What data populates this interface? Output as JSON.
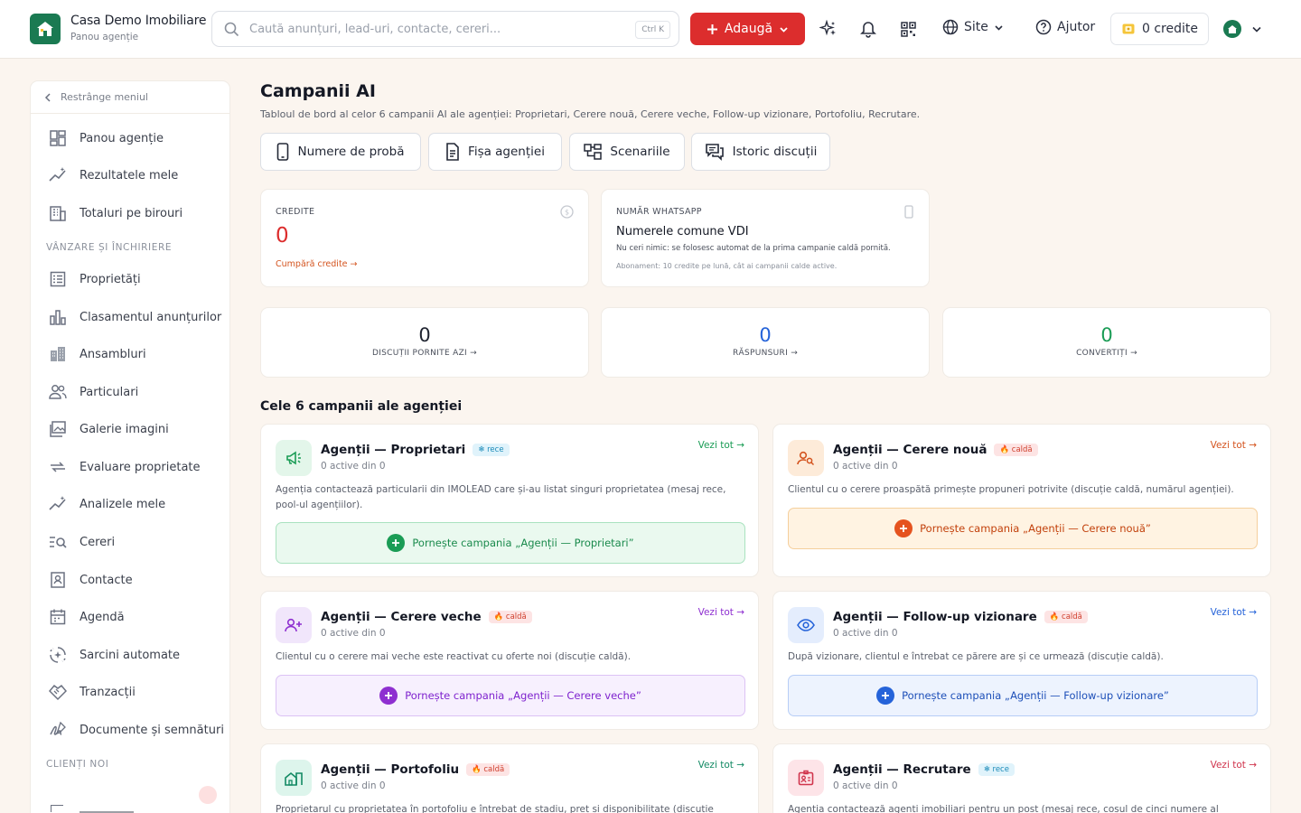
{
  "header": {
    "brand_title": "Casa Demo Imobiliare",
    "brand_sub": "Panou agenție",
    "search_placeholder": "Caută anunțuri, lead-uri, contacte, cereri...",
    "search_kbd": "Ctrl K",
    "add_label": "Adaugă",
    "site_label": "Site",
    "help_label": "Ajutor",
    "credits_label": "0  credite"
  },
  "sidebar": {
    "collapse_label": "Restrânge meniul",
    "items_top": [
      {
        "label": "Panou agenție"
      },
      {
        "label": "Rezultatele mele"
      },
      {
        "label": "Totaluri pe birouri"
      }
    ],
    "section_sales": "VÂNZARE ȘI ÎNCHIRIERE",
    "items_sales": [
      {
        "label": "Proprietăți"
      },
      {
        "label": "Clasamentul anunțurilor"
      },
      {
        "label": "Ansambluri"
      },
      {
        "label": "Particulari"
      },
      {
        "label": "Galerie imagini"
      },
      {
        "label": "Evaluare proprietate"
      },
      {
        "label": "Analizele mele"
      },
      {
        "label": "Cereri"
      },
      {
        "label": "Contacte"
      },
      {
        "label": "Agendă"
      },
      {
        "label": "Sarcini automate"
      },
      {
        "label": "Tranzacții"
      },
      {
        "label": "Documente și semnături"
      }
    ],
    "section_clients": "CLIENȚI NOI"
  },
  "page": {
    "title": "Campanii AI",
    "subtitle": "Tabloul de bord al celor 6 campanii AI ale agenției: Proprietari, Cerere nouă, Cerere veche, Follow-up vizionare, Portofoliu, Recrutare.",
    "tools": [
      "Numere de probă",
      "Fișa agenției",
      "Scenariile",
      "Istoric discuții"
    ]
  },
  "credits_card": {
    "label": "CREDITE",
    "value": "0",
    "link": "Cumpără credite →"
  },
  "whatsapp_card": {
    "label": "NUMĂR WHATSAPP",
    "title": "Numerele comune VDI",
    "desc": "Nu ceri nimic: se folosesc automat de la prima campanie caldă pornită.",
    "note": "Abonament: 10 credite pe lună, cât ai campanii calde active."
  },
  "stats": [
    {
      "value": "0",
      "label": "DISCUȚII PORNITE AZI →",
      "color": "#1f2430"
    },
    {
      "value": "0",
      "label": "RĂSPUNSURI →",
      "color": "#2563d9"
    },
    {
      "value": "0",
      "label": "CONVERTIȚI →",
      "color": "#1a9c55"
    }
  ],
  "campaigns_title": "Cele 6 campanii ale agenției",
  "campaigns": [
    {
      "title": "Agenții — Proprietari",
      "badge": "❄ rece",
      "status": "0 active din 0",
      "view": "Vezi tot →",
      "desc": "Agenția contactează particularii din IMOLEAD care și-au listat singuri proprietatea (mesaj rece, pool-ul agențiilor).",
      "button": "Pornește campania „Agenții — Proprietari”"
    },
    {
      "title": "Agenții — Cerere nouă",
      "badge": "🔥 caldă",
      "status": "0 active din 0",
      "view": "Vezi tot →",
      "desc": "Clientul cu o cerere proaspătă primește propuneri potrivite (discuție caldă, numărul agenției).",
      "button": "Pornește campania „Agenții — Cerere nouă”"
    },
    {
      "title": "Agenții — Cerere veche",
      "badge": "🔥 caldă",
      "status": "0 active din 0",
      "view": "Vezi tot →",
      "desc": "Clientul cu o cerere mai veche este reactivat cu oferte noi (discuție caldă).",
      "button": "Pornește campania „Agenții — Cerere veche”"
    },
    {
      "title": "Agenții — Follow-up vizionare",
      "badge": "🔥 caldă",
      "status": "0 active din 0",
      "view": "Vezi tot →",
      "desc": "După vizionare, clientul e întrebat ce părere are și ce urmează (discuție caldă).",
      "button": "Pornește campania „Agenții — Follow-up vizionare”"
    },
    {
      "title": "Agenții — Portofoliu",
      "badge": "🔥 caldă",
      "status": "0 active din 0",
      "view": "Vezi tot →",
      "desc": "Proprietarul cu proprietatea în portofoliu e întrebat de stadiu, preț și disponibilitate (discuție caldă).",
      "button": ""
    },
    {
      "title": "Agenții — Recrutare",
      "badge": "❄ rece",
      "status": "0 active din 0",
      "view": "Vezi tot →",
      "desc": "Agenția contactează agenți imobiliari pentru un post (mesaj rece, coșul de cinci numere al recrutării).",
      "button": ""
    }
  ]
}
